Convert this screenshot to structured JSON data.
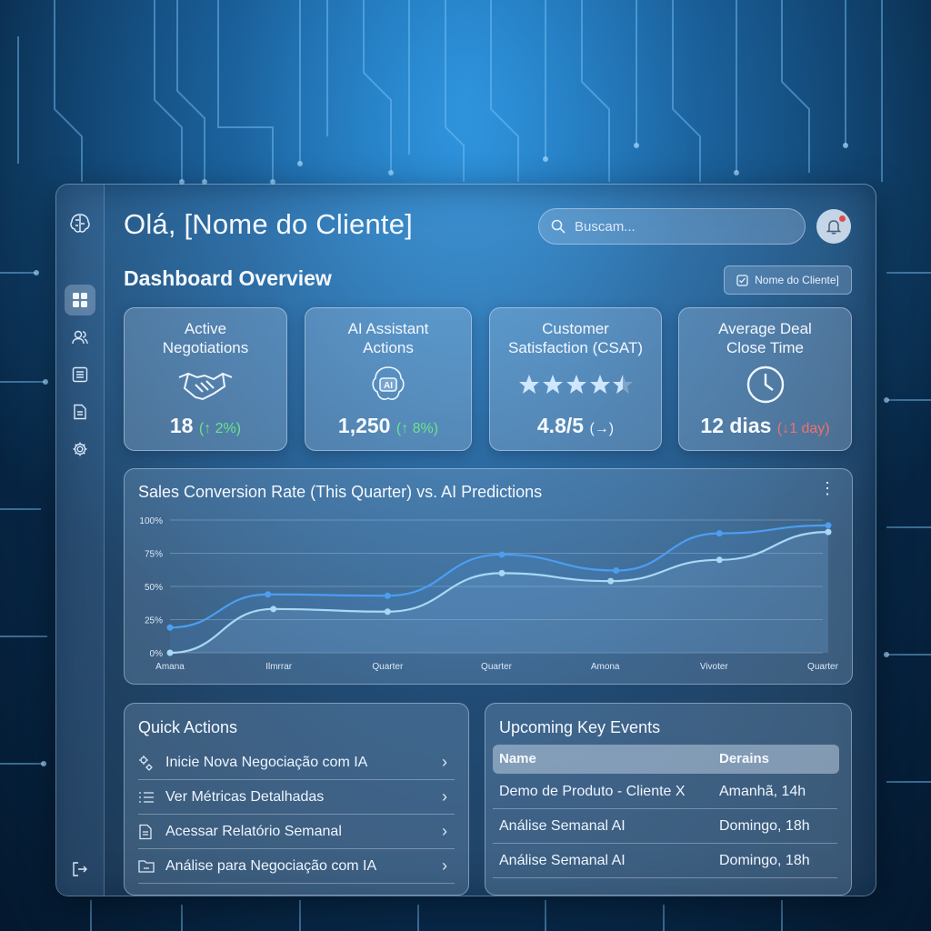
{
  "header": {
    "greeting": "Olá, [Nome do Cliente]",
    "search_placeholder": "Buscam...",
    "page_subtitle": "Dashboard Overview",
    "client_button_label": "Nome do Cliente]"
  },
  "sidebar": {
    "items": [
      {
        "icon": "dashboard-grid-icon",
        "active": true
      },
      {
        "icon": "users-icon",
        "active": false
      },
      {
        "icon": "list-icon",
        "active": false
      },
      {
        "icon": "document-icon",
        "active": false
      },
      {
        "icon": "gear-icon",
        "active": false
      }
    ],
    "logout_icon": "logout-icon",
    "logo_icon": "ai-brain-logo-icon"
  },
  "kpis": [
    {
      "title_line1": "Active",
      "title_line2": "Negotiations",
      "icon": "handshake-icon",
      "value": "18",
      "delta": "(↑ 2%)",
      "trend": "up"
    },
    {
      "title_line1": "AI Assistant",
      "title_line2": "Actions",
      "icon": "ai-brain-icon",
      "icon_text": "AI",
      "value": "1,250",
      "delta": "(↑ 8%)",
      "trend": "up"
    },
    {
      "title_line1": "Customer",
      "title_line2": "Satisfaction (CSAT)",
      "icon": "star-rating-icon",
      "rating": 4.5,
      "value": "4.8/5",
      "delta": "(→)",
      "trend": "neutral"
    },
    {
      "title_line1": "Average Deal",
      "title_line2": "Close Time",
      "icon": "clock-icon",
      "value": "12 dias",
      "delta": "(↓1 day)",
      "trend": "down"
    }
  ],
  "chart": {
    "title": "Sales Conversion Rate (This Quarter) vs. AI Predictions",
    "menu_icon": "kebab-menu-icon"
  },
  "chart_data": {
    "type": "line",
    "title": "Sales Conversion Rate (This Quarter) vs. AI Predictions",
    "xlabel": "",
    "ylabel": "",
    "x": [
      "Amana",
      "Ilmrrar",
      "Quarter",
      "Quarter",
      "Amona",
      "Vivoter",
      "Quarter"
    ],
    "yticks": [
      "0%",
      "25%",
      "50%",
      "75%",
      "100%"
    ],
    "ylim": [
      0,
      100
    ],
    "grid": true,
    "legend": "none",
    "colors": {
      "series_a": "#4c9ef0",
      "series_b": "#a9d8f5"
    },
    "series": [
      {
        "points": [
          [
            0,
            19
          ],
          [
            0.9,
            44
          ],
          [
            2,
            43
          ],
          [
            3.05,
            74
          ],
          [
            4.1,
            62
          ],
          [
            5.05,
            90
          ],
          [
            6.05,
            96
          ]
        ]
      },
      {
        "points": [
          [
            0,
            0
          ],
          [
            0.95,
            33
          ],
          [
            2,
            31
          ],
          [
            3.05,
            60
          ],
          [
            4.05,
            54
          ],
          [
            5.05,
            70
          ],
          [
            6.05,
            91
          ]
        ]
      }
    ]
  },
  "quick_actions": {
    "title": "Quick Actions",
    "items": [
      {
        "label": "Inicie Nova Negociação com IA",
        "icon": "ai-negotiation-icon"
      },
      {
        "label": "Ver Métricas Detalhadas",
        "icon": "list-icon"
      },
      {
        "label": "Acessar Relatório Semanal",
        "icon": "document-icon"
      },
      {
        "label": "Análise para Negociação com IA",
        "icon": "folder-icon"
      }
    ],
    "chevron": "›"
  },
  "events": {
    "title": "Upcoming Key Events",
    "columns": [
      "Name",
      "Derains"
    ],
    "rows": [
      [
        "Demo de Produto - Cliente X",
        "Amanhã, 14h"
      ],
      [
        "Análise Semanal AI",
        "Domingo, 18h"
      ],
      [
        "Análise Semanal AI",
        "Domingo, 18h"
      ]
    ]
  }
}
